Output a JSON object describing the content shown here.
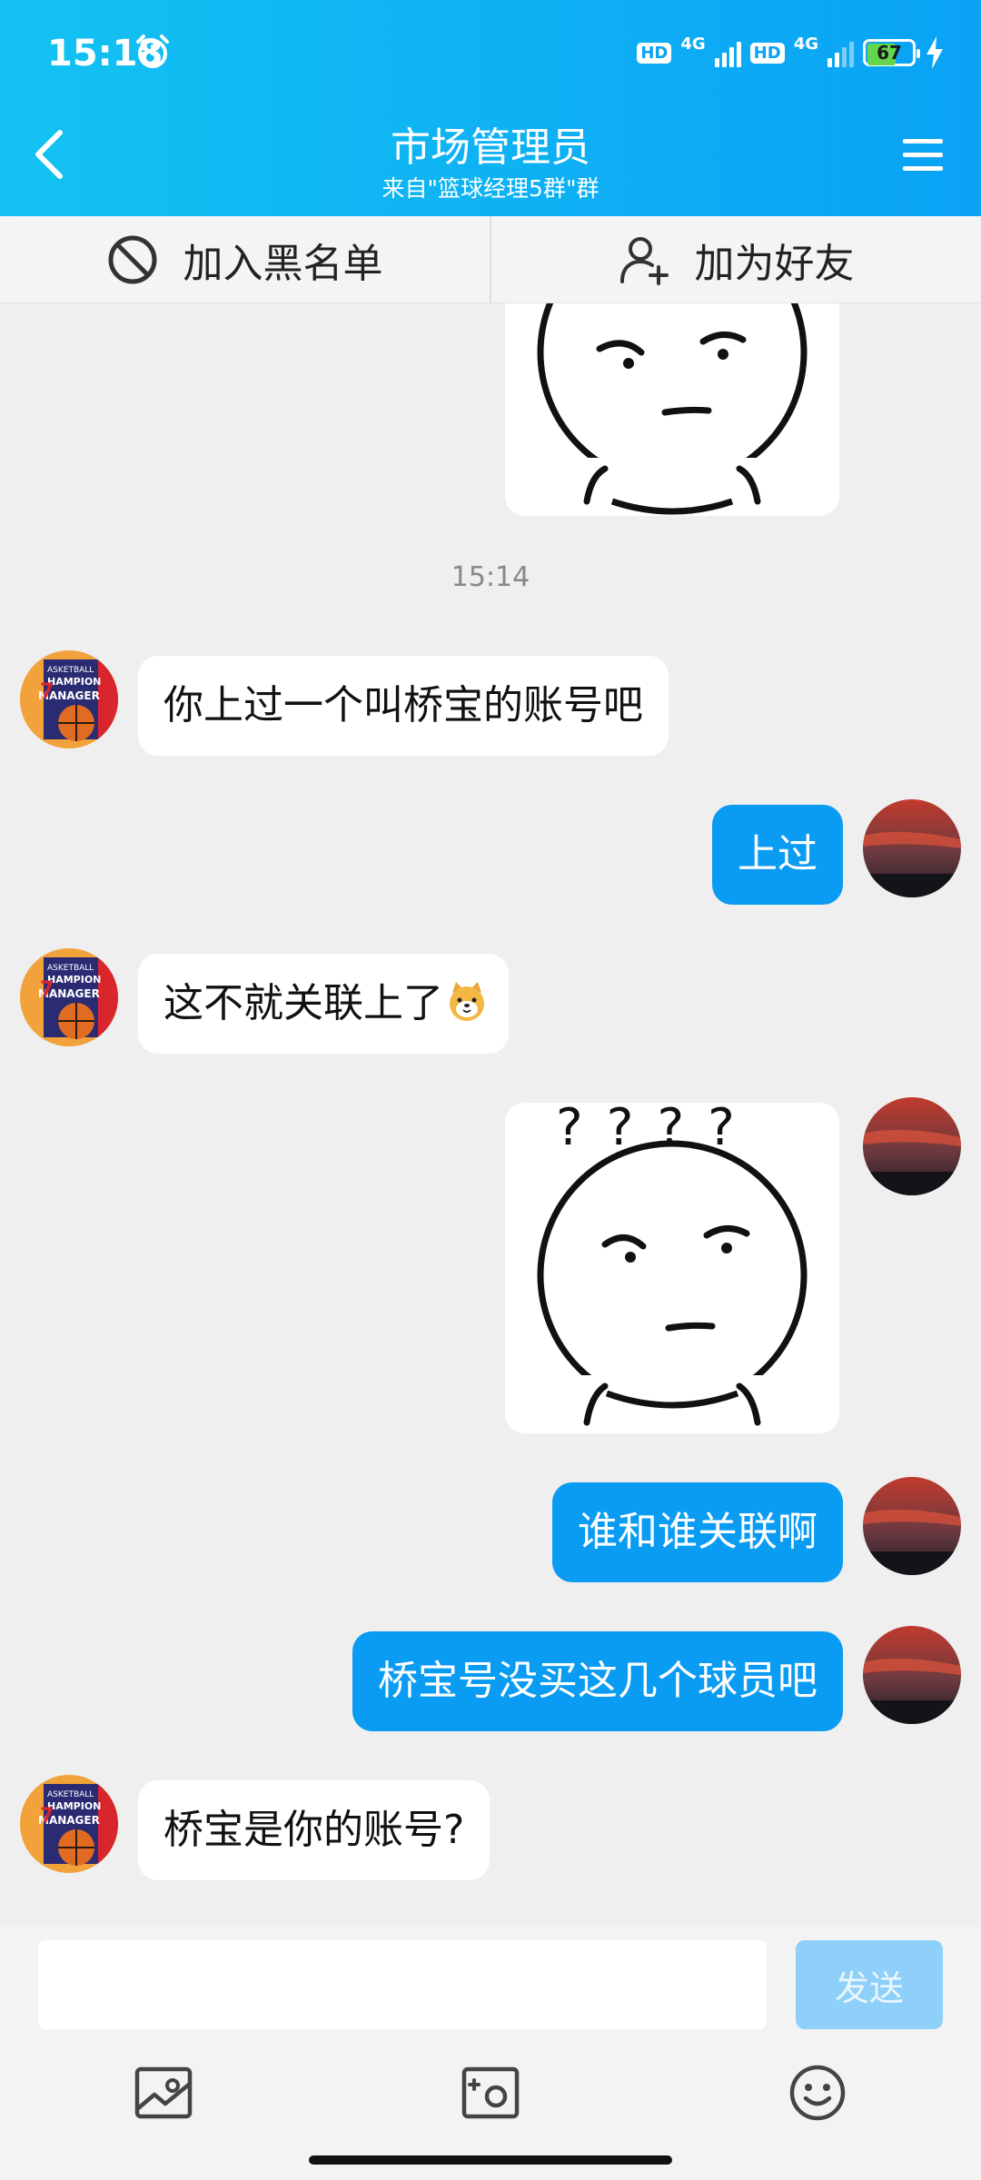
{
  "status_bar": {
    "time": "15:18",
    "hd1": "HD",
    "net1": "4G",
    "hd2": "HD",
    "net2": "4G",
    "battery": "67",
    "battery_level": 0.67
  },
  "header": {
    "title": "市场管理员",
    "subtitle": "来自\"篮球经理5群\"群",
    "colors": {
      "start": "#13c2f2",
      "end": "#0aa2f5"
    }
  },
  "actions": {
    "blacklist": "加入黑名单",
    "add_friend": "加为好友"
  },
  "chat": {
    "timestamp": "15:14",
    "messages": [
      {
        "from": "other",
        "type": "text",
        "text": "你上过一个叫桥宝的账号吧"
      },
      {
        "from": "me",
        "type": "text",
        "text": "上过"
      },
      {
        "from": "other",
        "type": "text",
        "text": "这不就关联上了"
      },
      {
        "from": "me",
        "type": "sticker",
        "sticker_text": "????"
      },
      {
        "from": "me",
        "type": "text",
        "text": "谁和谁关联啊"
      },
      {
        "from": "me",
        "type": "text",
        "text": "桥宝号没买这几个球员吧"
      },
      {
        "from": "other",
        "type": "text",
        "text": "桥宝是你的账号?"
      }
    ]
  },
  "input": {
    "placeholder": "",
    "send_label": "发送"
  },
  "icons": {
    "back": "chevron-left-icon",
    "menu": "menu-icon",
    "blacklist": "ban-icon",
    "add_friend": "add-user-icon",
    "emoji": "dog-emoji-icon",
    "image": "image-icon",
    "camera": "camera-icon",
    "smile": "smile-icon"
  },
  "accent_color": "#0a9bf2"
}
